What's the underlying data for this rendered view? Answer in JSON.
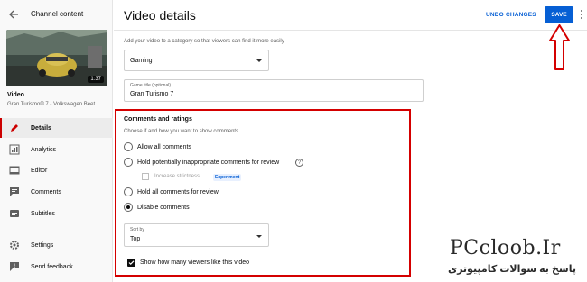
{
  "sidebar": {
    "title": "Channel content",
    "video_label": "Video",
    "video_name": "Gran Turismo® 7 - Volkswagen Beet...",
    "thumb_duration": "1:37",
    "items": [
      {
        "label": "Details",
        "icon": "pencil-icon",
        "active": true
      },
      {
        "label": "Analytics",
        "icon": "analytics-icon"
      },
      {
        "label": "Editor",
        "icon": "editor-icon"
      },
      {
        "label": "Comments",
        "icon": "comments-icon"
      },
      {
        "label": "Subtitles",
        "icon": "subtitles-icon"
      },
      {
        "label": "Settings",
        "icon": "gear-icon"
      },
      {
        "label": "Send feedback",
        "icon": "feedback-icon"
      }
    ]
  },
  "header": {
    "title": "Video details",
    "undo_label": "UNDO CHANGES",
    "save_label": "SAVE"
  },
  "category": {
    "help": "Add your video to a category so that viewers can find it more easily",
    "value": "Gaming"
  },
  "game_title": {
    "label": "Game title (optional)",
    "value": "Gran Turismo 7"
  },
  "comments": {
    "title": "Comments and ratings",
    "help": "Choose if and how you want to show comments",
    "options": [
      {
        "label": "Allow all comments",
        "selected": false
      },
      {
        "label": "Hold potentially inappropriate comments for review",
        "selected": false
      },
      {
        "label": "Hold all comments for review",
        "selected": false
      },
      {
        "label": "Disable comments",
        "selected": true
      }
    ],
    "strictness_label": "Increase strictness",
    "experiment_badge": "Experiment",
    "sort_label": "Sort by",
    "sort_value": "Top",
    "show_likes_label": "Show how many viewers like this video"
  },
  "watermark": {
    "title": "PCcloob.Ir",
    "subtitle": "پاسخ به سوالات کامپیوتری"
  },
  "colors": {
    "accent": "#065fd4",
    "highlight": "#d40000"
  }
}
